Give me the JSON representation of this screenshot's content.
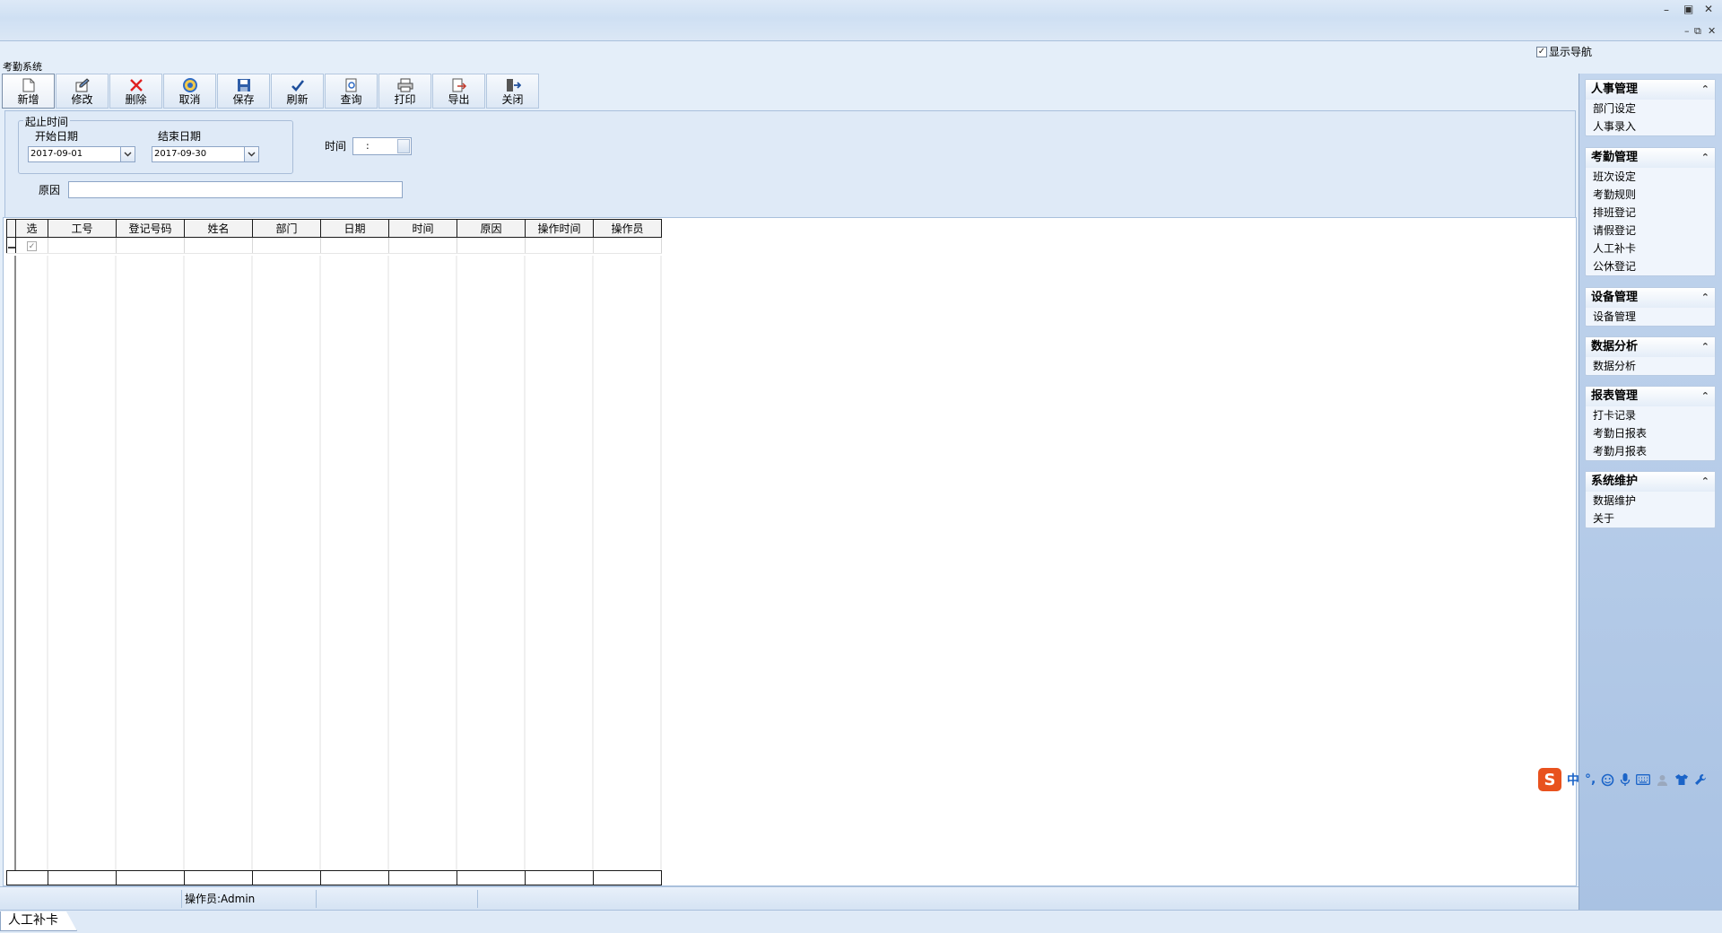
{
  "window": {
    "minimize": "–",
    "restore": "▣",
    "close": "✕",
    "child_minimize": "–",
    "child_restore": "⧉",
    "child_close": "✕"
  },
  "app_caption": "考勤系统",
  "show_nav": {
    "label": "显示导航",
    "checked": true,
    "mark": "✓"
  },
  "toolbar": [
    {
      "label": "新增",
      "icon": "new-document-icon"
    },
    {
      "label": "修改",
      "icon": "edit-icon"
    },
    {
      "label": "删除",
      "icon": "delete-icon"
    },
    {
      "label": "取消",
      "icon": "cancel-icon"
    },
    {
      "label": "保存",
      "icon": "save-icon"
    },
    {
      "label": "刷新",
      "icon": "check-icon"
    },
    {
      "label": "查询",
      "icon": "query-icon"
    },
    {
      "label": "打印",
      "icon": "print-icon"
    },
    {
      "label": "导出",
      "icon": "export-icon"
    },
    {
      "label": "关闭",
      "icon": "exit-icon"
    }
  ],
  "form": {
    "range_group_title": "起止时间",
    "start_label": "开始日期",
    "end_label": "结束日期",
    "start_value": "2017-09-01",
    "end_value": "2017-09-30",
    "time_label": "时间",
    "time_value": ":",
    "reason_label": "原因",
    "reason_value": ""
  },
  "grid": {
    "columns": [
      "选",
      "工号",
      "登记号码",
      "姓名",
      "部门",
      "日期",
      "时间",
      "原因",
      "操作时间",
      "操作员"
    ],
    "rows": [
      {
        "selected": true,
        "mark": "✓",
        "cells": [
          "",
          "",
          "",
          "",
          "",
          "",
          "",
          "",
          ""
        ]
      }
    ]
  },
  "status": {
    "operator": "操作员:Admin"
  },
  "tabs": [
    {
      "label": "人工补卡"
    }
  ],
  "nav": {
    "groups": [
      {
        "title": "人事管理",
        "items": [
          "部门设定",
          "人事录入"
        ]
      },
      {
        "title": "考勤管理",
        "items": [
          "班次设定",
          "考勤规则",
          "排班登记",
          "请假登记",
          "人工补卡",
          "公休登记"
        ]
      },
      {
        "title": "设备管理",
        "items": [
          "设备管理"
        ]
      },
      {
        "title": "数据分析",
        "items": [
          "数据分析"
        ]
      },
      {
        "title": "报表管理",
        "items": [
          "打卡记录",
          "考勤日报表",
          "考勤月报表"
        ]
      },
      {
        "title": "系统维护",
        "items": [
          "数据维护",
          "关于"
        ]
      }
    ],
    "collapse_glyph": "⌃"
  },
  "ime": {
    "logo": "S",
    "mode": "中",
    "punct": "°,"
  }
}
